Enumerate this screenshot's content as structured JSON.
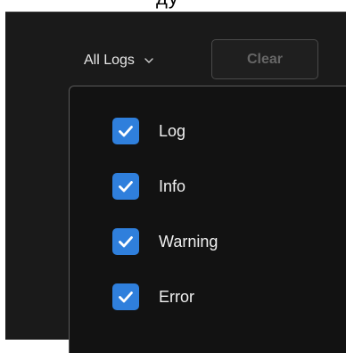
{
  "toolbar": {
    "filter_label": "All Logs",
    "clear_label": "Clear"
  },
  "top_fragment": "ду",
  "options": [
    {
      "label": "Log",
      "checked": true
    },
    {
      "label": "Info",
      "checked": true
    },
    {
      "label": "Warning",
      "checked": true
    },
    {
      "label": "Error",
      "checked": true
    }
  ],
  "colors": {
    "panel_bg": "#1a1a1a",
    "dropdown_bg": "#121212",
    "checkbox": "#2f7fdc",
    "disabled_text": "#666666"
  },
  "icons": {
    "filter_chevron": "chevron-down-icon",
    "checkmark": "checkmark-icon"
  }
}
